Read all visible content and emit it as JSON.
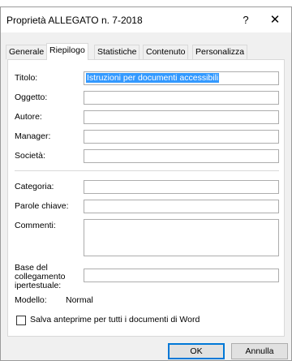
{
  "window": {
    "title": "Proprietà ALLEGATO n. 7-2018",
    "help_label": "?",
    "close_label": "✕"
  },
  "tabs": [
    {
      "label": "Generale",
      "active": false
    },
    {
      "label": "Riepilogo",
      "active": true
    },
    {
      "label": "Statistiche",
      "active": false
    },
    {
      "label": "Contenuto",
      "active": false
    },
    {
      "label": "Personalizza",
      "active": false
    }
  ],
  "summary": {
    "titolo": {
      "label": "Titolo:",
      "value": "Istruzioni per documenti accessibili"
    },
    "oggetto": {
      "label": "Oggetto:",
      "value": ""
    },
    "autore": {
      "label": "Autore:",
      "value": ""
    },
    "manager": {
      "label": "Manager:",
      "value": ""
    },
    "societa": {
      "label": "Società:",
      "value": ""
    },
    "categoria": {
      "label": "Categoria:",
      "value": ""
    },
    "parole_chiave": {
      "label": "Parole chiave:",
      "value": ""
    },
    "commenti": {
      "label": "Commenti:",
      "value": ""
    },
    "base_collegamento": {
      "label_line1": "Base del",
      "label_line2": "collegamento",
      "label_line3": "ipertestuale:",
      "value": ""
    },
    "modello": {
      "label": "Modello:",
      "value": "Normal"
    },
    "anteprime": {
      "label": "Salva anteprime per tutti i documenti di Word",
      "checked": false
    }
  },
  "buttons": {
    "ok": "OK",
    "annulla": "Annulla"
  },
  "colors": {
    "selection": "#3399ff",
    "primary_border": "#0078d7"
  }
}
